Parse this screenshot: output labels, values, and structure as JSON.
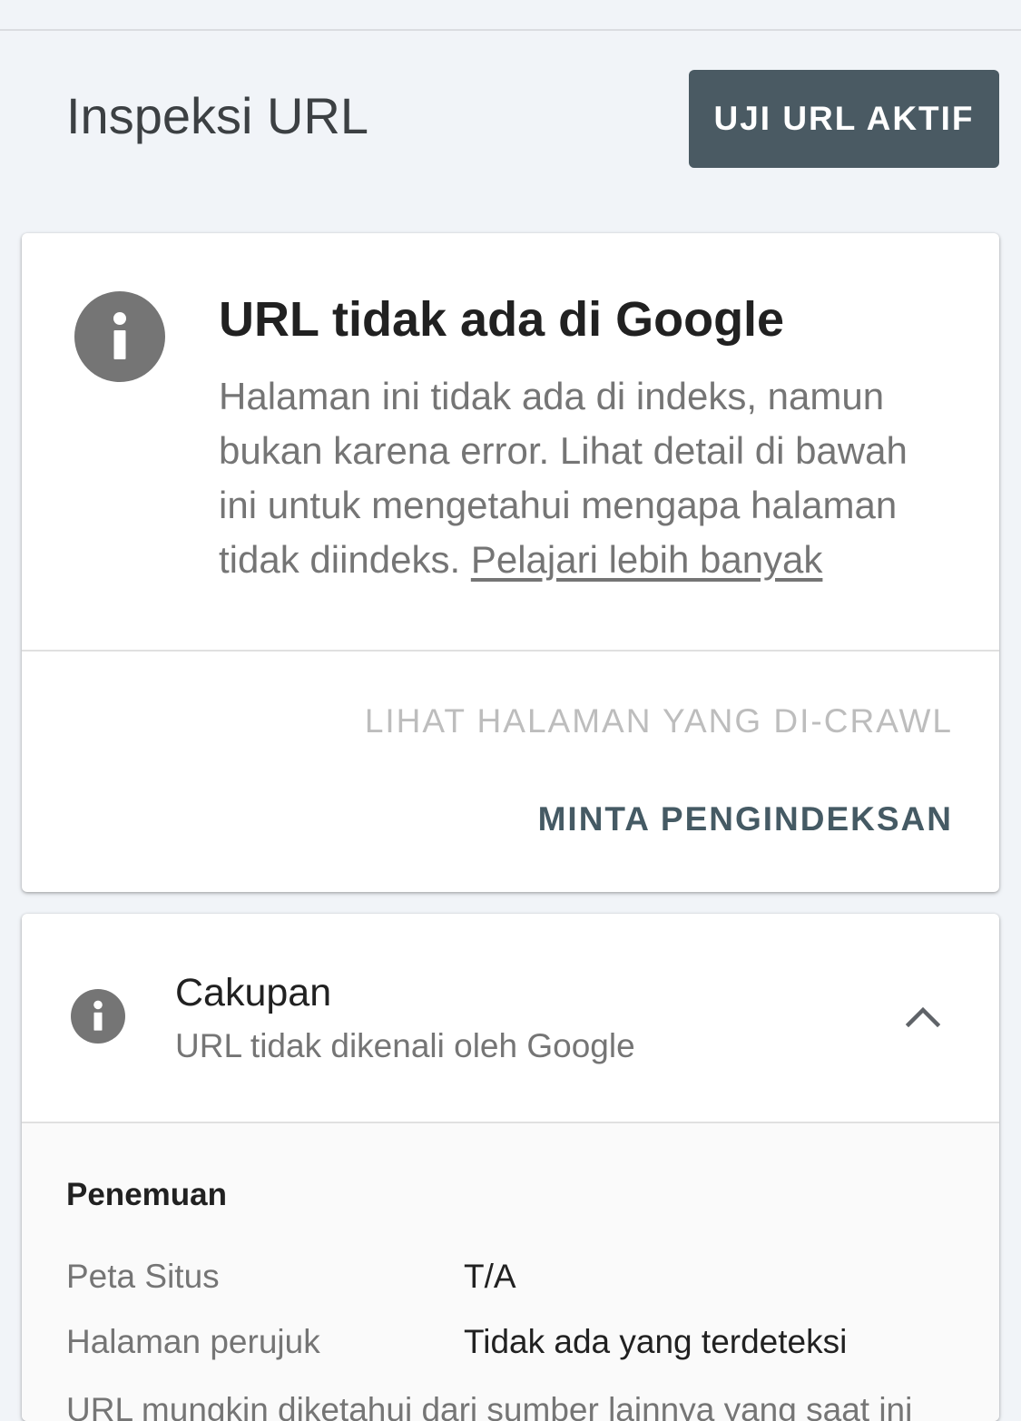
{
  "header": {
    "title": "Inspeksi URL",
    "test_live_button": "UJI URL AKTIF"
  },
  "status_card": {
    "icon": "info-icon",
    "title": "URL tidak ada di Google",
    "description": "Halaman ini tidak ada di indeks, namun bukan karena error. Lihat detail di bawah ini untuk mengetahui mengapa halaman tidak diindeks.",
    "learn_more": "Pelajari lebih banyak",
    "view_crawled_button": "LIHAT HALAMAN YANG DI-CRAWL",
    "request_indexing_button": "MINTA PENGINDEKSAN"
  },
  "coverage_card": {
    "icon": "info-icon",
    "title": "Cakupan",
    "subtitle": "URL tidak dikenali oleh Google",
    "expand_icon": "chevron-up-icon",
    "section_title": "Penemuan",
    "rows": [
      {
        "label": "Peta Situs",
        "value": "T/A"
      },
      {
        "label": "Halaman perujuk",
        "value": "Tidak ada yang terdeteksi"
      }
    ],
    "note": "URL mungkin diketahui dari sumber lainnya yang saat ini"
  },
  "colors": {
    "background": "#f1f4f8",
    "primary_button": "#4a5a63",
    "action_text": "#455a64",
    "disabled_text": "#bdbdbd",
    "info_icon": "#757575"
  }
}
